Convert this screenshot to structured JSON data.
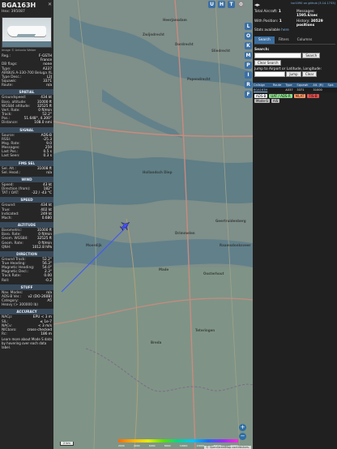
{
  "aircraft": {
    "callsign": "BGA163H",
    "hex_label": "Hex: 395087",
    "photo_credit": "Image © Antonio Weber",
    "basic": [
      {
        "k": "Reg.:",
        "v": "F-GSTH"
      },
      {
        "k": "",
        "v": "France"
      },
      {
        "k": "DB flags:",
        "v": "none"
      },
      {
        "k": "Type:",
        "v": "A337"
      },
      {
        "k": "AIRBUS A-330-700 Beluga XL",
        "v": ""
      },
      {
        "k": "Type Desc.:",
        "v": "L2J"
      },
      {
        "k": "Squawk:",
        "v": "3371"
      },
      {
        "k": "Route:",
        "v": "n/a"
      }
    ],
    "sections": [
      {
        "title": "SPATIAL",
        "rows": [
          {
            "k": "Groundspeed:",
            "v": "434 kt"
          },
          {
            "k": "Baro. altitude:",
            "v": "31000 ft"
          },
          {
            "k": "WGS84 altitude:",
            "v": "32525 ft"
          },
          {
            "k": "Vert. Rate:",
            "v": "0 ft/min"
          },
          {
            "k": "Track:",
            "v": "52.2°"
          },
          {
            "k": "Pos.:",
            "v": "51.648°, 4.300°"
          },
          {
            "k": "Distance:",
            "v": "108.0 nmi"
          }
        ]
      },
      {
        "title": "SIGNAL",
        "rows": [
          {
            "k": "Source:",
            "v": "ADS-B"
          },
          {
            "k": "RSSI:",
            "v": "-25.3"
          },
          {
            "k": "Msg. Rate:",
            "v": "9.0"
          },
          {
            "k": "Messages:",
            "v": "259"
          },
          {
            "k": "Last Pos.:",
            "v": "0.5 s"
          },
          {
            "k": "Last Seen:",
            "v": "0.3 s"
          }
        ]
      },
      {
        "title": "FMS SEL",
        "rows": [
          {
            "k": "Sel. Alt.:",
            "v": "31008 ft"
          },
          {
            "k": "Sel. Head.:",
            "v": "n/a"
          }
        ]
      },
      {
        "title": "WIND",
        "rows": [
          {
            "k": "Speed:",
            "v": "43 kt"
          },
          {
            "k": "Direction (from):",
            "v": "182°"
          },
          {
            "k": "TAT / OAT:",
            "v": "-22 / -43 °C"
          }
        ]
      },
      {
        "title": "SPEED",
        "rows": [
          {
            "k": "Ground:",
            "v": "434 kt"
          },
          {
            "k": "True:",
            "v": "402 kt"
          },
          {
            "k": "Indicated:",
            "v": "249 kt"
          },
          {
            "k": "Mach:",
            "v": "0.680"
          }
        ]
      },
      {
        "title": "ALTITUDE",
        "rows": [
          {
            "k": "Barometric:",
            "v": "31000 ft"
          },
          {
            "k": "Baro. Rate:",
            "v": "0 ft/min"
          },
          {
            "k": "Geom. WGS84:",
            "v": "32525 ft"
          },
          {
            "k": "Geom. Rate:",
            "v": "0 ft/min"
          },
          {
            "k": "QNH:",
            "v": "1012.8 hPa"
          }
        ]
      },
      {
        "title": "DIRECTION",
        "rows": [
          {
            "k": "Ground Track:",
            "v": "52.2°"
          },
          {
            "k": "True Heading:",
            "v": "56.3°"
          },
          {
            "k": "Magnetic Heading:",
            "v": "54.0°"
          },
          {
            "k": "Magnetic Decl.:",
            "v": "2.3°"
          },
          {
            "k": "Track Rate:",
            "v": "0.00"
          },
          {
            "k": "Roll:",
            "v": "-0.2"
          }
        ]
      },
      {
        "title": "STUFF",
        "rows": [
          {
            "k": "Nav. Modes:",
            "v": "n/a"
          },
          {
            "k": "ADS-B Ver.:",
            "v": "v2 (DO-260B)"
          },
          {
            "k": "Category:",
            "v": "A5"
          },
          {
            "k": "Heavy (> 300000 lb)",
            "v": ""
          }
        ]
      },
      {
        "title": "ACCURACY",
        "rows": [
          {
            "k": "NACp:",
            "v": "EPU < 3 m"
          },
          {
            "k": "SIL:",
            "v": "≤ 1e-7"
          },
          {
            "k": "NACv:",
            "v": "< 3 m/s"
          },
          {
            "k": "NICbaro:",
            "v": "cross-checked"
          },
          {
            "k": "Rc:",
            "v": "186 m"
          }
        ]
      }
    ],
    "learn_more": "Learn more about Mode S data by hovering over each data label."
  },
  "map": {
    "top_buttons": [
      "U",
      "H",
      "T"
    ],
    "side_buttons": [
      "L",
      "O",
      "K",
      "M",
      "P",
      "I",
      "R",
      "F"
    ],
    "top_right_icon": "gear-icon",
    "towns": [
      "Heerjansdam",
      "Dordrecht",
      "Zwijndrecht",
      "Sliedrecht",
      "Papendrecht",
      "Moerdijk",
      "Hollandsch Diep",
      "Drimmelen",
      "Made",
      "Oosterhout",
      "Geertruidenberg",
      "Raamsdonksveer",
      "Breda",
      "Teteringen"
    ],
    "scale_label": "2 km",
    "altitude_ticks": [
      "2000",
      "4000",
      "6000",
      "8000",
      "10000",
      "20000",
      "30000",
      "40000"
    ],
    "attribution": "© OpenStreetMap contributors.",
    "zoom_in": "+",
    "zoom_out": "−",
    "colors": {
      "track": "#3d55ff",
      "aircraft": "#4450ff"
    }
  },
  "sidebar": {
    "github_link": "tar1090 on github (3.14.1733)",
    "stats": [
      {
        "label": "Total Aircraft:",
        "value": "1"
      },
      {
        "label": "Messages:",
        "value": "1595.6/sec"
      },
      {
        "label": "With Position:",
        "value": "1"
      },
      {
        "label": "History:",
        "value": "30529 positions"
      }
    ],
    "stats_available": "Stats available",
    "stats_link": "here",
    "tabs": [
      "Search",
      "Filters",
      "Columns"
    ],
    "search_label": "Search:",
    "search_button": "Search",
    "clear_search_button": "Clear Search",
    "jump_label": "Jump to Airport or Latitude, Longitude:",
    "jump_button": "Jump",
    "clear_button": "Clear",
    "table_headers": [
      "Callsign",
      "Route",
      "Type",
      "Squawk",
      "Alt. (ft)",
      "Spd."
    ],
    "table_rows": [
      [
        "BGA163H",
        "",
        "A337",
        "3371",
        "31000",
        ""
      ]
    ],
    "legend": [
      {
        "label": "ADS-B",
        "color": "#f0f0f0"
      },
      {
        "label": "UAT / ADS-R",
        "color": "#8bd98b"
      },
      {
        "label": "MLAT",
        "color": "#ff9966"
      },
      {
        "label": "TIS-B",
        "color": "#e05050"
      },
      {
        "label": "Mode-S",
        "color": "#bbbbbb"
      },
      {
        "label": "AIS",
        "color": "#bbbbbb"
      }
    ]
  }
}
